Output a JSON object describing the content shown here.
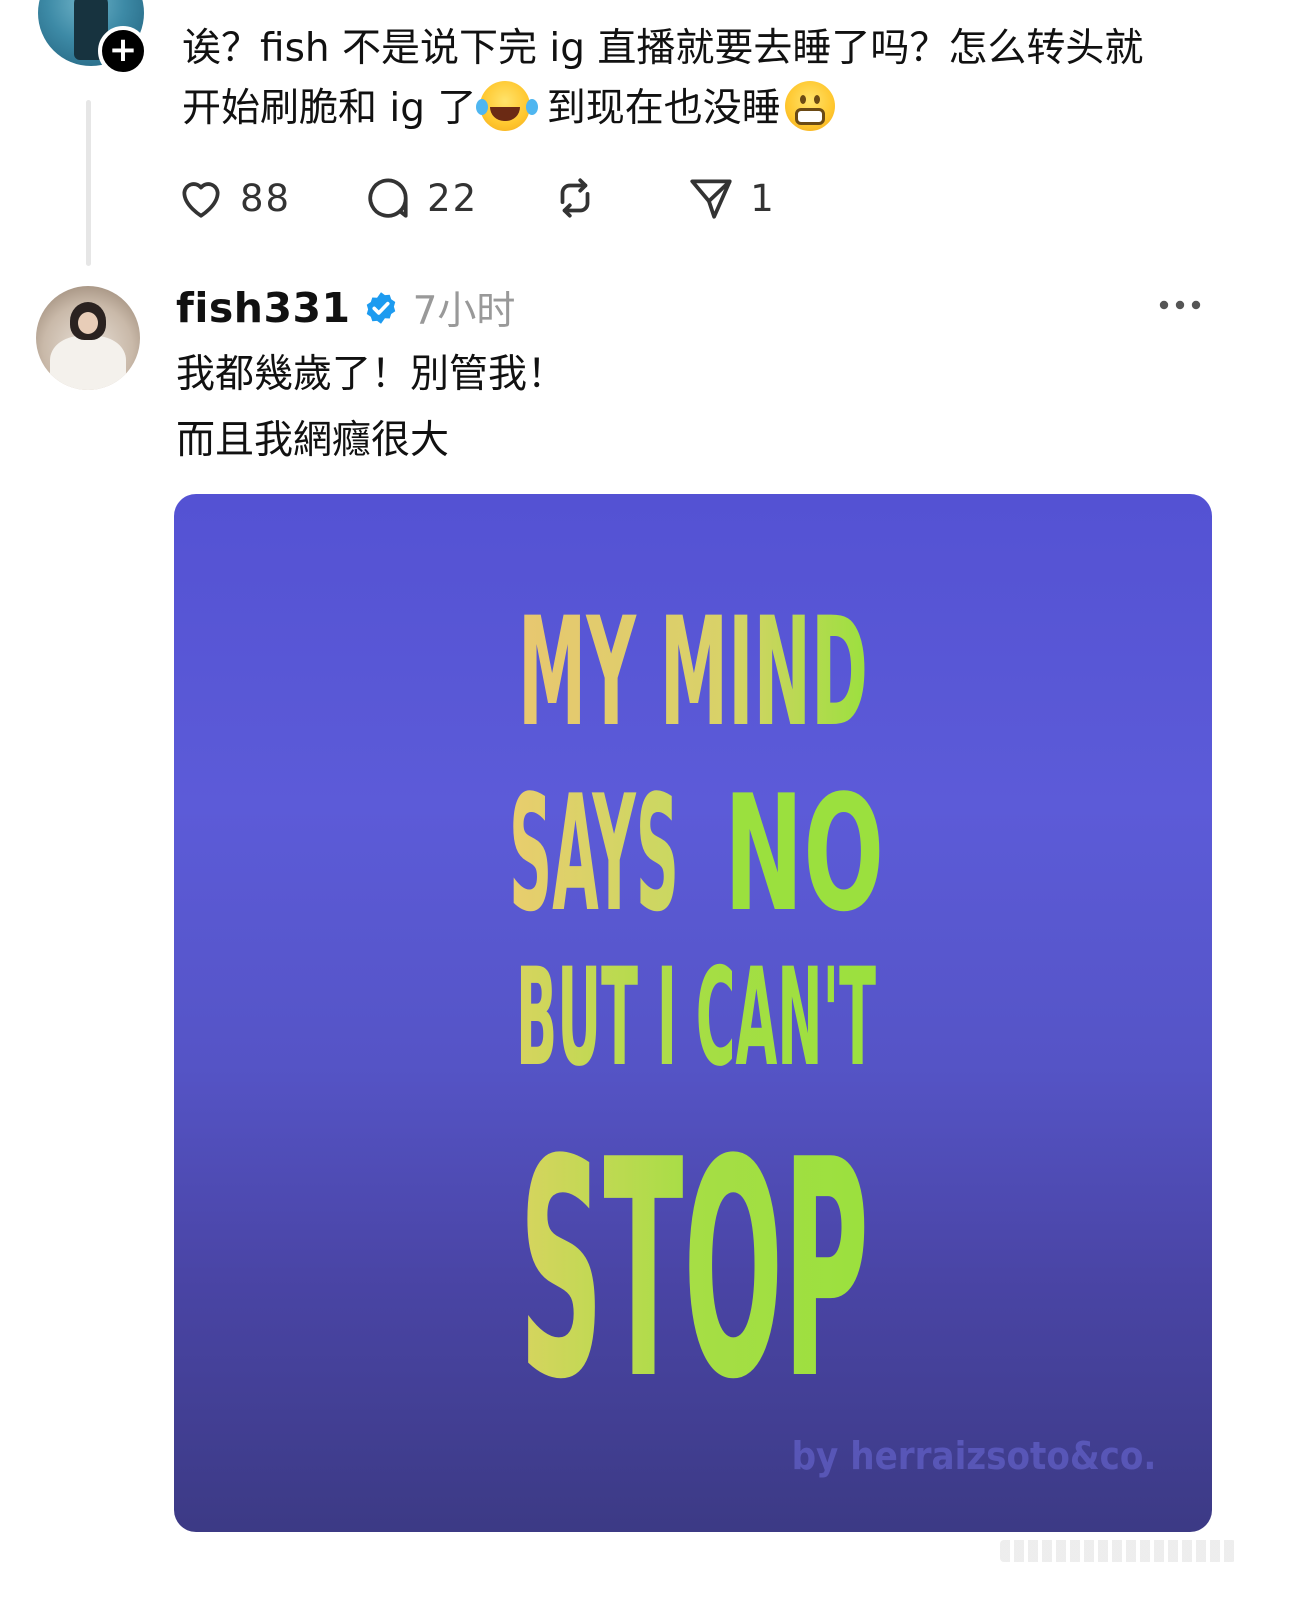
{
  "first_post": {
    "text_line1": "诶？fish 不是说下完 ig 直播就要去睡了吗？怎么转头就",
    "text_line2_a": "开始刷脆和 ig 了",
    "text_line2_b": " 到现在也没睡",
    "emoji_1": "face-with-tears-of-joy",
    "emoji_2": "grimacing-face",
    "follow_icon": "plus-icon"
  },
  "actions": {
    "like_count": "88",
    "reply_count": "22",
    "repost_count": "",
    "share_count": "1"
  },
  "reply": {
    "username": "fish331",
    "verified": true,
    "time": "7小时",
    "line1": "我都幾歲了！別管我！",
    "line2": "而且我網癮很大"
  },
  "image": {
    "line1": "MY MIND",
    "line2a": "SAYS",
    "line2b": "NO",
    "line3": "BUT I CAN'T",
    "line4": "STOP",
    "credit": "by herraizsoto&co.",
    "bg_color": "#5654d2",
    "text_yellow": "#e7cf66",
    "text_green": "#9be03e"
  }
}
